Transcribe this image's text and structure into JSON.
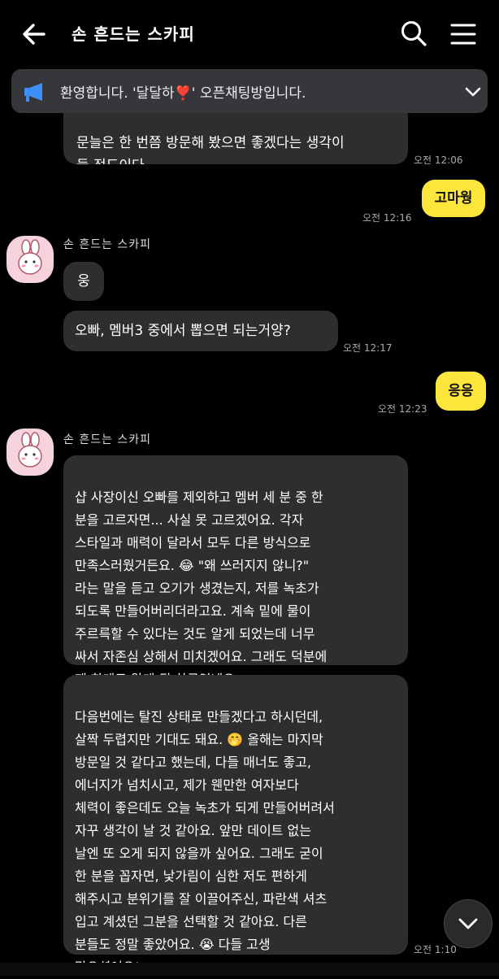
{
  "header": {
    "title": "손 흔드는 스카피",
    "icons": [
      "back-arrow-icon",
      "search-icon",
      "menu-icon"
    ]
  },
  "notice": {
    "text": "환영합니다. '달달하❣️' 오픈채팅방입니다.",
    "icon": "megaphone-icon"
  },
  "messages": [
    {
      "from": "other",
      "text": "문늘은 한 번쯤 방문해 봤으면 좋겠다는 생각이\n들 정도이다.",
      "time": "오전 12:06"
    },
    {
      "from": "me",
      "text": "고마웡",
      "time": "오전 12:16"
    },
    {
      "from": "other",
      "sender": "손 흔드는 스카피",
      "text": "웅",
      "time": ""
    },
    {
      "from": "other",
      "text": "오빠, 멤버3 중에서 뽑으면 되는거양?",
      "time": "오전 12:17"
    },
    {
      "from": "me",
      "text": "응응",
      "time": "오전 12:23"
    },
    {
      "from": "other",
      "sender": "손 흔드는 스카피",
      "text": "샵 사장이신 오빠를 제외하고 멤버 세 분 중 한\n분을 고르자면... 사실 못 고르겠어요. 각자\n스타일과 매력이 달라서 모두 다른 방식으로\n만족스러웠거든요. 😂 \"왜 쓰러지지 않니?\"\n라는 말을 듣고 오기가 생겼는지, 저를 녹초가\n되도록 만들어버리더라고요. 계속 밑에 물이\n주르륵할 수 있다는 것도 알게 되었는데 너무\n싸서 자존심 상해서 미치겠어요. 그래도 덕분에\n제 한계도 알게 된 하루였네요.",
      "time": ""
    },
    {
      "from": "other",
      "text": "다음번에는 탈진 상태로 만들겠다고 하시던데,\n살짝 두렵지만 기대도 돼요. 🤭 올해는 마지막\n방문일 것 같다고 했는데, 다들 매너도 좋고,\n에너지가 넘치시고, 제가 웬만한 여자보다\n체력이 좋은데도 오늘 녹초가 되게 만들어버려서\n자꾸 생각이 날 것 같아요. 앞만 데이트 없는\n날엔 또 오게 되지 않을까 싶어요. 그래도 굳이\n한 분을 꼽자면, 낯가림이 심한 저도 편하게\n해주시고 분위기를 잘 이끌어주신, 파란색 셔츠\n입고 계셨던 그분을 선택할 것 같아요. 다른\n분들도 정말 좋았어요. 😭 다들 고생\n많으셨어요!",
      "time": "오전 1:10"
    }
  ],
  "colors": {
    "background": "#000000",
    "bubble_other": "#2e2e2e",
    "bubble_me": "#fde63c",
    "notice_bg": "#35373b",
    "megaphone": "#3e8ef7"
  }
}
